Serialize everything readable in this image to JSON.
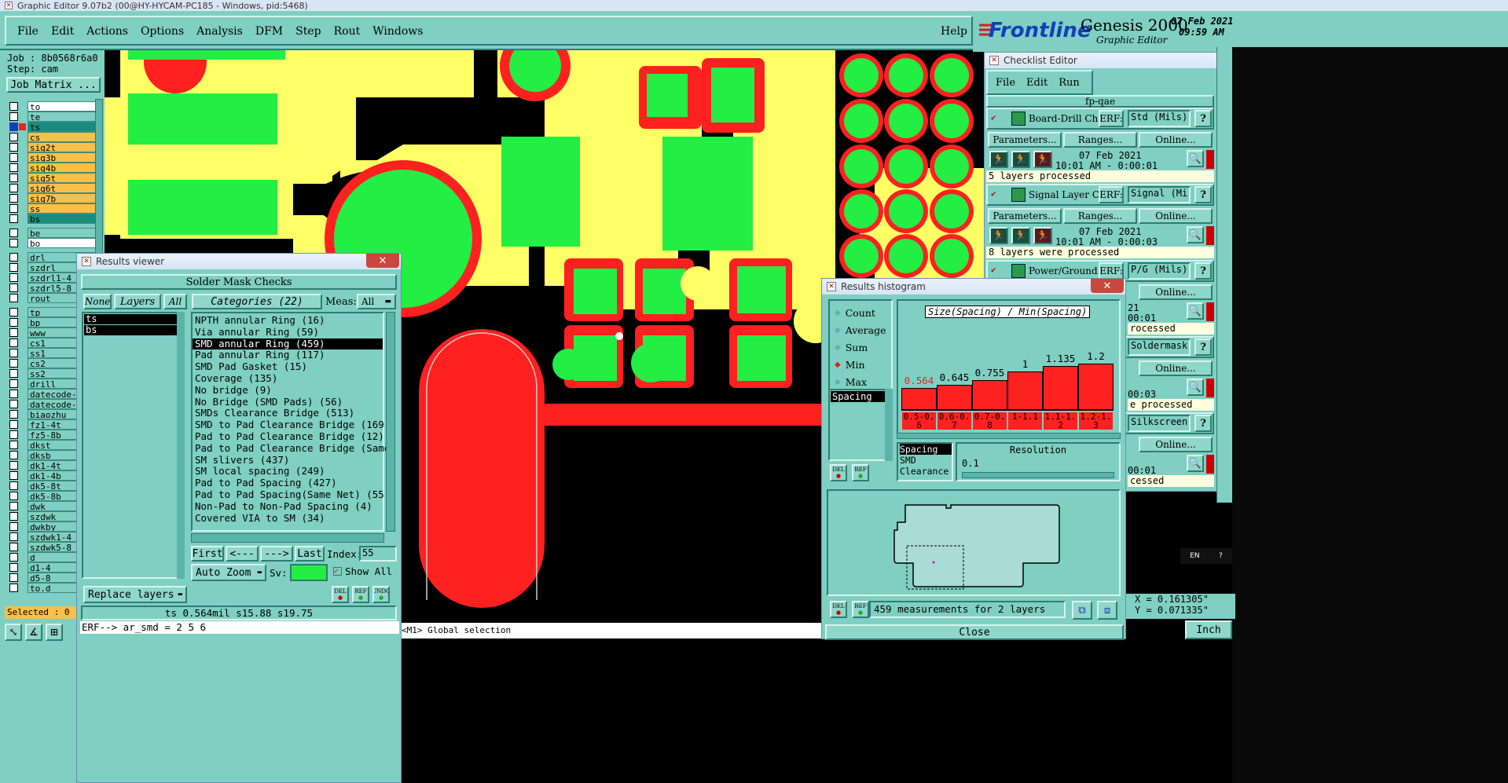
{
  "app_title": "Graphic Editor 9.07b2 (00@HY-HYCAM-PC185 - Windows, pid:5468)",
  "menu": [
    "File",
    "Edit",
    "Actions",
    "Options",
    "Analysis",
    "DFM",
    "Step",
    "Rout",
    "Windows"
  ],
  "help_label": "Help",
  "brand": {
    "logo": "Frontline",
    "product": "Genesis 2000",
    "subtitle": "Graphic Editor",
    "date": "07 Feb 2021",
    "time": "09:59 AM"
  },
  "job": {
    "job": "Job : 8b0568r6a0",
    "step": "Step: cam",
    "matrix_button": "Job Matrix ..."
  },
  "layers": [
    {
      "name": "to",
      "color": "#ffffff",
      "dropdown": true
    },
    {
      "name": "te",
      "color": "#7fcfc3"
    },
    {
      "name": "ts",
      "color": "#1a8c7c",
      "active": true
    },
    {
      "name": "cs",
      "color": "#f7c04a"
    },
    {
      "name": "sig2t",
      "color": "#f7c04a"
    },
    {
      "name": "sig3b",
      "color": "#f7c04a"
    },
    {
      "name": "sig4b",
      "color": "#f7c04a"
    },
    {
      "name": "sig5t",
      "color": "#f7c04a"
    },
    {
      "name": "sig6t",
      "color": "#f7c04a"
    },
    {
      "name": "sig7b",
      "color": "#f7c04a"
    },
    {
      "name": "ss",
      "color": "#f7c04a"
    },
    {
      "name": "bs",
      "color": "#1a8c7c"
    },
    {
      "name": "be",
      "color": "#7fcfc3"
    },
    {
      "name": "bo",
      "color": "#ffffff"
    },
    {
      "name": "drl",
      "color": "#7fcfc3"
    },
    {
      "name": "szdrl",
      "color": "#7fcfc3"
    },
    {
      "name": "szdrl1-4",
      "color": "#7fcfc3"
    },
    {
      "name": "szdrl5-8",
      "color": "#7fcfc3"
    },
    {
      "name": "rout",
      "color": "#7fcfc3"
    },
    {
      "name": "tp",
      "color": "#7fcfc3"
    },
    {
      "name": "bp",
      "color": "#7fcfc3"
    },
    {
      "name": "www",
      "color": "#7fcfc3"
    },
    {
      "name": "cs1",
      "color": "#7fcfc3"
    },
    {
      "name": "ss1",
      "color": "#7fcfc3"
    },
    {
      "name": "cs2",
      "color": "#7fcfc3"
    },
    {
      "name": "ss2",
      "color": "#7fcfc3"
    },
    {
      "name": "drill",
      "color": "#7fcfc3"
    },
    {
      "name": "datecode-",
      "color": "#7fcfc3"
    },
    {
      "name": "datecode-",
      "color": "#7fcfc3"
    },
    {
      "name": "biaozhu",
      "color": "#7fcfc3"
    },
    {
      "name": "fz1-4t",
      "color": "#7fcfc3"
    },
    {
      "name": "fz5-8b",
      "color": "#7fcfc3"
    },
    {
      "name": "dkst",
      "color": "#7fcfc3"
    },
    {
      "name": "dksb",
      "color": "#7fcfc3"
    },
    {
      "name": "dk1-4t",
      "color": "#7fcfc3"
    },
    {
      "name": "dk1-4b",
      "color": "#7fcfc3"
    },
    {
      "name": "dk5-8t",
      "color": "#7fcfc3"
    },
    {
      "name": "dk5-8b",
      "color": "#7fcfc3"
    },
    {
      "name": "dwk",
      "color": "#7fcfc3"
    },
    {
      "name": "szdwk",
      "color": "#7fcfc3"
    },
    {
      "name": "dwkby",
      "color": "#7fcfc3"
    },
    {
      "name": "szdwk1-4",
      "color": "#7fcfc3"
    },
    {
      "name": "szdwk5-8",
      "color": "#7fcfc3"
    },
    {
      "name": "d",
      "color": "#7fcfc3"
    },
    {
      "name": "d1-4",
      "color": "#7fcfc3"
    },
    {
      "name": "d5-8",
      "color": "#7fcfc3"
    },
    {
      "name": "to.d",
      "color": "#7fcfc3"
    }
  ],
  "selected_count": "Selected : 0",
  "results_viewer": {
    "title": "Results viewer",
    "heading": "Solder Mask Checks",
    "none_btn": "None",
    "layers_btn": "Layers",
    "all_btn": "All",
    "categories_btn": "Categories (22)",
    "meas_label": "Meas:",
    "meas_value": "All",
    "layer_items": [
      "ts",
      "bs"
    ],
    "categories": [
      "NPTH annular Ring (16)",
      "Via annular Ring (59)",
      "SMD annular Ring (459)",
      "Pad annular Ring (117)",
      "SMD Pad Gasket (15)",
      "Coverage (135)",
      "No bridge (9)",
      "No Bridge (SMD Pads) (56)",
      "SMDs Clearance Bridge (513)",
      "SMD to Pad Clearance Bridge (169)",
      "Pad to Pad Clearance Bridge (12)",
      "Pad to Pad Clearance Bridge (Same",
      "SM slivers (437)",
      "SM local spacing (249)",
      "Pad to Pad Spacing (427)",
      "Pad to Pad Spacing(Same Net) (55)",
      "Non-Pad to Non-Pad Spacing (4)",
      "Covered VIA to SM (34)"
    ],
    "selected_category": 2,
    "nav": {
      "first": "First",
      "prev": "<---",
      "next": "--->",
      "last": "Last",
      "index_label": "Index:",
      "index_value": "55"
    },
    "auto_zoom": "Auto Zoom",
    "sv_label": "Sv:",
    "show_all": "Show All",
    "replace_layers": "Replace layers",
    "status": "ts 0.564mil  s15.88  s19.75"
  },
  "erf_line": "ERF--> ar_smd = 2 5 6",
  "status_bar": "<M1> Global selection",
  "checklist": {
    "title": "Checklist Editor",
    "menu": [
      "File",
      "Edit",
      "Run"
    ],
    "name": "fp-qae",
    "actions": [
      {
        "name": "Board-Drill Che",
        "erf": "ERF:",
        "erf_value": "Std (Mils)",
        "params": "Parameters...",
        "ranges": "Ranges...",
        "online": "Online...",
        "date": "07 Feb 2021",
        "time": "10:01 AM - 0:00:01",
        "status": "5 layers processed"
      },
      {
        "name": "Signal Layer Ch",
        "erf": "ERF:",
        "erf_value": "Signal (Mi",
        "params": "Parameters...",
        "ranges": "Ranges...",
        "online": "Online...",
        "date": "07 Feb 2021",
        "time": "10:01 AM - 0:00:03",
        "status": "8 layers were processed"
      },
      {
        "name": "Power/Ground C",
        "erf": "ERF:",
        "erf_value": "P/G (Mils)",
        "online": "Online...",
        "date": "21",
        "time": "00:01",
        "status": "rocessed"
      },
      {
        "erf_value": "Soldermask",
        "online": "Online...",
        "time": "00:03",
        "status": "e processed"
      },
      {
        "erf_value": "Silkscreen",
        "online": "Online...",
        "time": "00:01",
        "status": "cessed"
      }
    ]
  },
  "histogram": {
    "title": "Results histogram",
    "modes": [
      "Count",
      "Average",
      "Sum",
      "Min",
      "Max"
    ],
    "active_mode": "Min",
    "measure_list": [
      "Spacing"
    ],
    "chart_title": "Size(Spacing) / Min(Spacing)",
    "bars": [
      {
        "value": "0.564",
        "range": "0.5-0.6",
        "level": 0.47
      },
      {
        "value": "0.645",
        "range": "0.6-0.7",
        "level": 0.54
      },
      {
        "value": "0.755",
        "range": "0.7-0.8",
        "level": 0.63
      },
      {
        "value": "1",
        "range": "1-1.1",
        "level": 0.83
      },
      {
        "value": "1.135",
        "range": "1.1-1.2",
        "level": 0.95
      },
      {
        "value": "1.2",
        "range": "1.2-1.3",
        "level": 1.0
      }
    ],
    "meas_types": [
      "Spacing",
      "SMD",
      "Clearance"
    ],
    "resolution_label": "Resolution",
    "resolution_value": "0.1",
    "summary": "459 measurements for 2 layers",
    "close": "Close"
  },
  "coords": {
    "x": "X = 0.161305\"",
    "y": "Y = 0.071335\""
  },
  "units": "Inch",
  "lang": "EN"
}
